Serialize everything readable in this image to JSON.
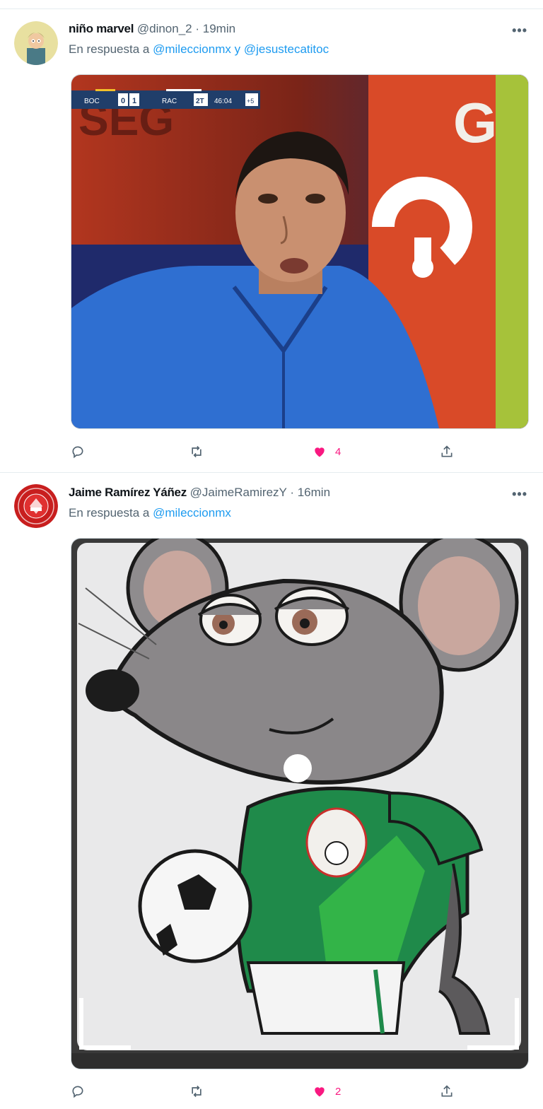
{
  "tweets": [
    {
      "name": "niño marvel",
      "handle": "@dinon_2",
      "sep": "·",
      "time": "19min",
      "reply_prefix": "En respuesta a",
      "mention1": "@mileccionmx",
      "conj": "y",
      "mention2": "@jesustecatitoc",
      "more": "•••",
      "scoreboard": {
        "home": "BOC",
        "home_score": "0",
        "away_score": "1",
        "away": "RAC",
        "period": "2T",
        "clock": "46:04",
        "added": "+5"
      },
      "likes": "4"
    },
    {
      "name": "Jaime Ramírez Yáñez",
      "handle": "@JaimeRamirezY",
      "sep": "·",
      "time": "16min",
      "reply_prefix": "En respuesta a",
      "mention1": "@mileccionmx",
      "more": "•••",
      "likes": "2"
    }
  ],
  "colors": {
    "accent": "#1d9bf0",
    "like": "#f91880",
    "muted": "#536471"
  },
  "icons": [
    "reply-icon",
    "retweet-icon",
    "like-icon",
    "share-icon",
    "more-icon"
  ]
}
